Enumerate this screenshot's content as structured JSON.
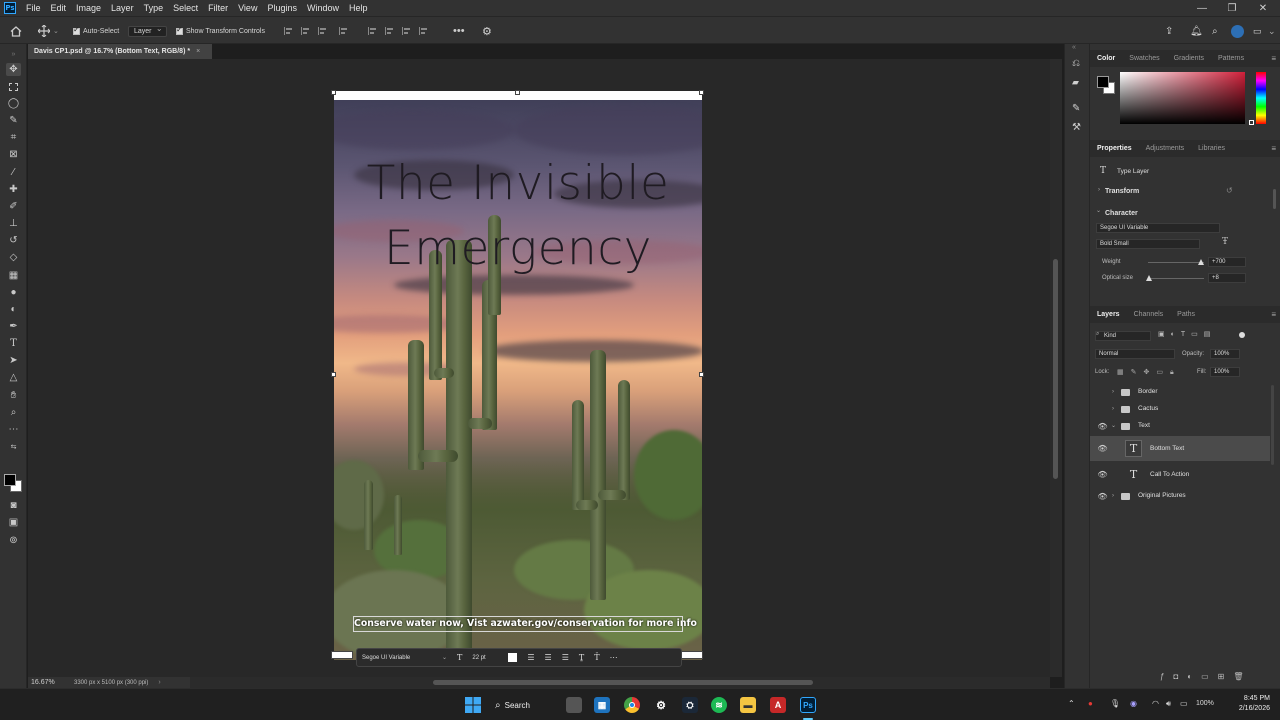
{
  "menubar": {
    "items": [
      "File",
      "Edit",
      "Image",
      "Layer",
      "Type",
      "Select",
      "Filter",
      "View",
      "Plugins",
      "Window",
      "Help"
    ],
    "app_logo": "Ps"
  },
  "options_bar": {
    "auto_select_label": "Auto-Select",
    "auto_select_target": "Layer",
    "show_transform_label": "Show Transform Controls"
  },
  "document": {
    "tab_title": "Davis CP1.psd @ 16.7% (Bottom Text, RGB/8) *",
    "title_text": "The Invisible Emergency",
    "title_line1": "The Invisible",
    "title_line2": "Emergency",
    "bottom_text": "Conserve water now, Vist azwater.gov/conservation for more info"
  },
  "context_bar": {
    "font": "Segoe UI Variable",
    "size": "22 pt"
  },
  "status": {
    "zoom": "16.67%",
    "doc_info": "3300 px x 5100 px (300 ppi)"
  },
  "color_panel": {
    "tabs": [
      "Color",
      "Swatches",
      "Gradients",
      "Patterns"
    ],
    "active_tab": "Color",
    "foreground": "#000000",
    "background": "#ffffff",
    "hue": "#d0203a"
  },
  "properties_panel": {
    "tabs": [
      "Properties",
      "Adjustments",
      "Libraries"
    ],
    "layer_type": "Type Layer",
    "transform_label": "Transform",
    "character_label": "Character",
    "font_family": "Segoe UI Variable",
    "font_style": "Bold Small",
    "weight_label": "Weight",
    "weight_value": "+700",
    "optical_label": "Optical size",
    "optical_value": "+8"
  },
  "layers_panel": {
    "tabs": [
      "Layers",
      "Channels",
      "Paths"
    ],
    "filter_label": "Kind",
    "blend_mode": "Normal",
    "opacity_label": "Opacity:",
    "opacity_value": "100%",
    "lock_label": "Lock:",
    "fill_label": "Fill:",
    "fill_value": "100%",
    "layers": [
      {
        "name": "Border",
        "kind": "group",
        "visible": false
      },
      {
        "name": "Cactus",
        "kind": "group",
        "visible": false
      },
      {
        "name": "Text",
        "kind": "group-open",
        "visible": true
      },
      {
        "name": "Bottom Text",
        "kind": "text",
        "visible": true,
        "selected": true
      },
      {
        "name": "Call To Action",
        "kind": "text",
        "visible": true
      },
      {
        "name": "Original Pictures",
        "kind": "group",
        "visible": true
      }
    ]
  },
  "taskbar": {
    "search_label": "Search",
    "battery": "100%",
    "time": "8:45 PM",
    "date": "2/16/2026"
  }
}
